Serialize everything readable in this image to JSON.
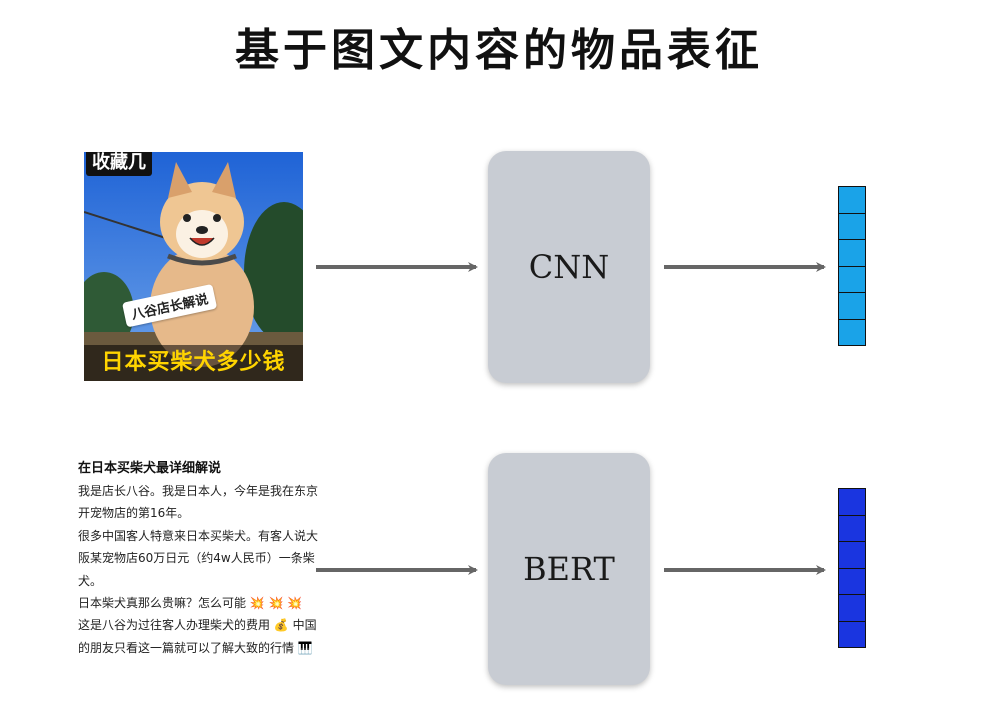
{
  "title": "基于图文内容的物品表征",
  "image_post": {
    "top_tag": "收藏几",
    "sticker": "八谷店长解说",
    "caption": "日本买柴犬多少钱"
  },
  "text_post": {
    "title": "在日本买柴犬最详细解说",
    "lines": [
      "我是店长八谷。我是日本人，今年是我在东京开宠物店的第16年。",
      "很多中国客人特意来日本买柴犬。有客人说大阪某宠物店60万日元（约4w人民币）一条柴犬。",
      "日本柴犬真那么贵嘛？怎么可能 💥 💥 💥",
      "这是八谷为过往客人办理柴犬的费用 💰 中国的朋友只看这一篇就可以了解大致的行情 🎹"
    ]
  },
  "models": {
    "image_model": "CNN",
    "text_model": "BERT"
  },
  "vectors": {
    "cells": 6,
    "image_color": "#1aa3e8",
    "text_color": "#1a35e0"
  }
}
